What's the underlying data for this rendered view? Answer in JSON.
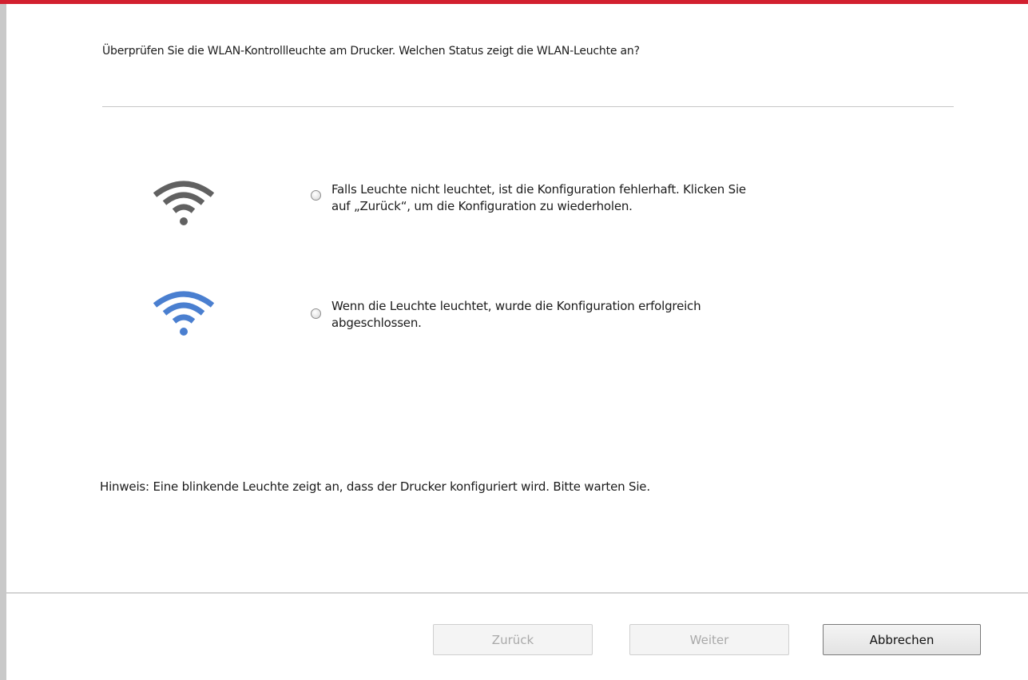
{
  "dialog": {
    "question": "Überprüfen Sie die WLAN-Kontrollleuchte am Drucker. Welchen Status zeigt die WLAN-Leuchte an?",
    "options": [
      {
        "icon": "wifi-off-icon",
        "icon_color": "#616161",
        "line1": "Falls Leuchte nicht leuchtet, ist die Konfiguration fehlerhaft. Klicken Sie",
        "line2": "auf „Zurück“, um die Konfiguration zu wiederholen."
      },
      {
        "icon": "wifi-on-icon",
        "icon_color": "#4a7fd0",
        "line1": "Wenn die Leuchte leuchtet, wurde die Konfiguration erfolgreich",
        "line2": "abgeschlossen."
      }
    ],
    "hint": "Hinweis:  Eine blinkende Leuchte zeigt an, dass der Drucker konfiguriert wird.  Bitte warten Sie."
  },
  "buttons": {
    "back_label": "Zurück",
    "next_label": "Weiter",
    "cancel_label": "Abbrechen"
  },
  "colors": {
    "accent_bar": "#d2202f"
  }
}
